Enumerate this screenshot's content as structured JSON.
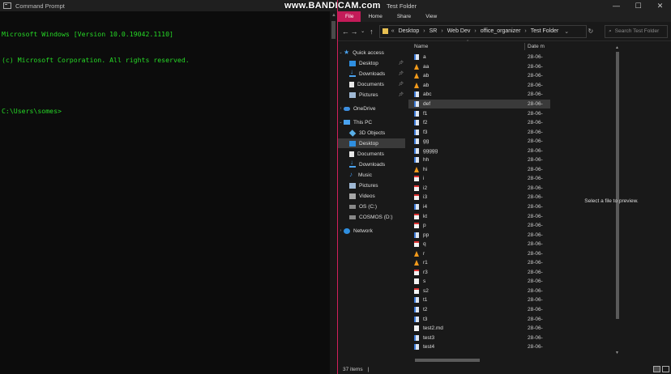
{
  "cmd": {
    "title": "Command Prompt",
    "lines": [
      "Microsoft Windows [Version 10.0.19042.1110]",
      "(c) Microsoft Corporation. All rights reserved.",
      "",
      "C:\\Users\\somes>"
    ],
    "text_color": "#26d826"
  },
  "watermark": "www.BANDICAM.com",
  "explorer": {
    "title": "Test Folder",
    "window_controls": [
      "—",
      "☐",
      "✕"
    ],
    "ribbon_tabs": [
      "File",
      "Home",
      "Share",
      "View"
    ],
    "accent": "#c41b59",
    "breadcrumb": [
      "Desktop",
      "SR",
      "Web Dev",
      "office_organizer",
      "Test Folder"
    ],
    "search_placeholder": "Search Test Folder",
    "nav": {
      "quick_access": "Quick access",
      "qa_items": [
        "Desktop",
        "Downloads",
        "Documents",
        "Pictures"
      ],
      "onedrive": "OneDrive",
      "this_pc": "This PC",
      "pc_items": [
        "3D Objects",
        "Desktop",
        "Documents",
        "Downloads",
        "Music",
        "Pictures",
        "Videos",
        "OS (C:)",
        "COSMOS (D:)"
      ],
      "network": "Network"
    },
    "columns": {
      "name": "Name",
      "date": "Date m"
    },
    "files": [
      {
        "name": "a",
        "type": "txt"
      },
      {
        "name": "aa",
        "type": "vlc"
      },
      {
        "name": "ab",
        "type": "vlc"
      },
      {
        "name": "ab",
        "type": "vlc"
      },
      {
        "name": "abc",
        "type": "txt"
      },
      {
        "name": "def",
        "type": "txt"
      },
      {
        "name": "f1",
        "type": "txt"
      },
      {
        "name": "f2",
        "type": "txt"
      },
      {
        "name": "f3",
        "type": "txt"
      },
      {
        "name": "gg",
        "type": "txt"
      },
      {
        "name": "ggggg",
        "type": "txt"
      },
      {
        "name": "hh",
        "type": "txt"
      },
      {
        "name": "hi",
        "type": "vlc"
      },
      {
        "name": "i",
        "type": "pdf"
      },
      {
        "name": "i2",
        "type": "pdf"
      },
      {
        "name": "i3",
        "type": "pdf"
      },
      {
        "name": "i4",
        "type": "txt"
      },
      {
        "name": "kt",
        "type": "pdf"
      },
      {
        "name": "p",
        "type": "pdf"
      },
      {
        "name": "pp",
        "type": "txt"
      },
      {
        "name": "q",
        "type": "pdf"
      },
      {
        "name": "r",
        "type": "vlc"
      },
      {
        "name": "r1",
        "type": "vlc"
      },
      {
        "name": "r3",
        "type": "pdf"
      },
      {
        "name": "s",
        "type": "blank"
      },
      {
        "name": "s2",
        "type": "pdf"
      },
      {
        "name": "t1",
        "type": "txt"
      },
      {
        "name": "t2",
        "type": "txt"
      },
      {
        "name": "t3",
        "type": "txt"
      },
      {
        "name": "test2.md",
        "type": "blank"
      },
      {
        "name": "test3",
        "type": "txt"
      },
      {
        "name": "test4",
        "type": "txt"
      }
    ],
    "date_prefix": "28-06-",
    "selected_file": "def",
    "preview_text": "Select a file to preview.",
    "status": {
      "count": "37 items",
      "sep": "|"
    }
  }
}
